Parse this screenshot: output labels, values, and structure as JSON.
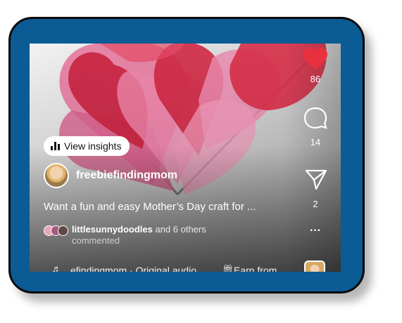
{
  "post": {
    "insights_label": "View insights",
    "username": "freebiefindingmom",
    "caption": "Want a fun and easy Mother’s Day craft for ...",
    "commenter_name": "littlesunnydoodles",
    "commenter_suffix": " and 6 others",
    "commented_label": "commented",
    "audio_label": "efindingmom · Original audio",
    "earn_label": "Earn from ..."
  },
  "actions": {
    "likes": "86",
    "comments": "14",
    "shares": "2",
    "more": "···"
  },
  "icons": {
    "like": "heart-icon",
    "comment": "comment-bubble-icon",
    "share": "paper-plane-icon",
    "music": "music-note-icon",
    "gift": "gift-icon",
    "insights": "bar-chart-icon"
  },
  "colors": {
    "frame": "#0b5b94",
    "like": "#e8313e"
  }
}
